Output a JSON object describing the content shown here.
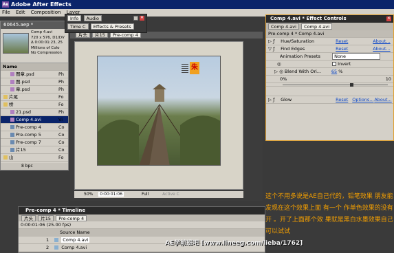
{
  "app": {
    "title": "Adobe After Effects",
    "logo": "Ae"
  },
  "menu": [
    "File",
    "Edit",
    "Composition",
    "Layer"
  ],
  "project": {
    "tab": "60645.aep *",
    "info_lines": [
      "Comp 4.avi",
      "720 x 576, D1/DV",
      "Δ 0:00:01:23, 25",
      "Millions of Colo",
      "No Compression"
    ],
    "col_name": "Name",
    "items": [
      {
        "name": "图章.psd",
        "type": "Ph"
      },
      {
        "name": "图.psd",
        "type": "Ph"
      },
      {
        "name": "章.psd",
        "type": "Ph"
      },
      {
        "name": "片尾",
        "type": "Fo"
      },
      {
        "name": "桥",
        "type": "Fo"
      },
      {
        "name": "21.psd",
        "type": "Ph"
      },
      {
        "name": "Comp 4.avi",
        "type": "Vi"
      },
      {
        "name": "Pre-comp 4",
        "type": "Co"
      },
      {
        "name": "Pre-comp 5",
        "type": "Co"
      },
      {
        "name": "Pre-comp 7",
        "type": "Co"
      },
      {
        "name": "片15",
        "type": "Co"
      },
      {
        "name": "山",
        "type": "Fo"
      }
    ],
    "footer": "8 bpc"
  },
  "info_panel": {
    "tabs": [
      "Info",
      "Audio"
    ],
    "tabs2": [
      "Time C",
      "Effects & Presets"
    ]
  },
  "comp_viewer": {
    "tabs": [
      "片头",
      "片15",
      "Pre-comp 4"
    ],
    "zoom": "50%",
    "timecode": "0:00:01:06",
    "resolution": "Full",
    "camera": "Active C"
  },
  "effect_controls": {
    "title": "Comp 4.avi * Effect Controls",
    "tabs": [
      "Comp 4.avi",
      "Comp 4.avi"
    ],
    "breadcrumb": "Pre-comp 4 * Comp 4.avi",
    "rows": [
      {
        "label": "Hue/Saturation",
        "reset": "Reset",
        "about": "About..."
      },
      {
        "label": "Find Edges",
        "reset": "Reset",
        "about": "About..."
      },
      {
        "label": "Animation Presets",
        "preset": "None"
      },
      {
        "label": "Invert"
      },
      {
        "label": "Blend With Ori...",
        "value": "65",
        "unit": "%"
      },
      {
        "label": "Glow",
        "reset": "Reset",
        "options": "Options...",
        "about": "About..."
      }
    ],
    "slider_min": "0%",
    "slider_max": "10"
  },
  "annotation": {
    "text": "这个不用多说是AE自己代的，铅笔效果 朋友能发现在这个效果上面 有一个 作单色效果的没有开 。开了上面那个效 果就是黑白水墨效果自己可以试试"
  },
  "timeline": {
    "title": "Pre-comp 4 * Timeline",
    "tabs": [
      "片头",
      "片15",
      "Pre-comp 4"
    ],
    "timecode": "0:00:01:06 (25.00 fps)",
    "col_source": "Source Name",
    "layers": [
      {
        "num": "1",
        "name": "Comp 4.avi"
      },
      {
        "num": "2",
        "name": "Comp 4.avi"
      }
    ]
  },
  "watermark": "AE学前班吧  [www.lineeg.com/lieba/1762]",
  "colors": {
    "accent": "#f0a000",
    "annotation_text": "#f5a000",
    "panel_border": "#e0a030"
  }
}
